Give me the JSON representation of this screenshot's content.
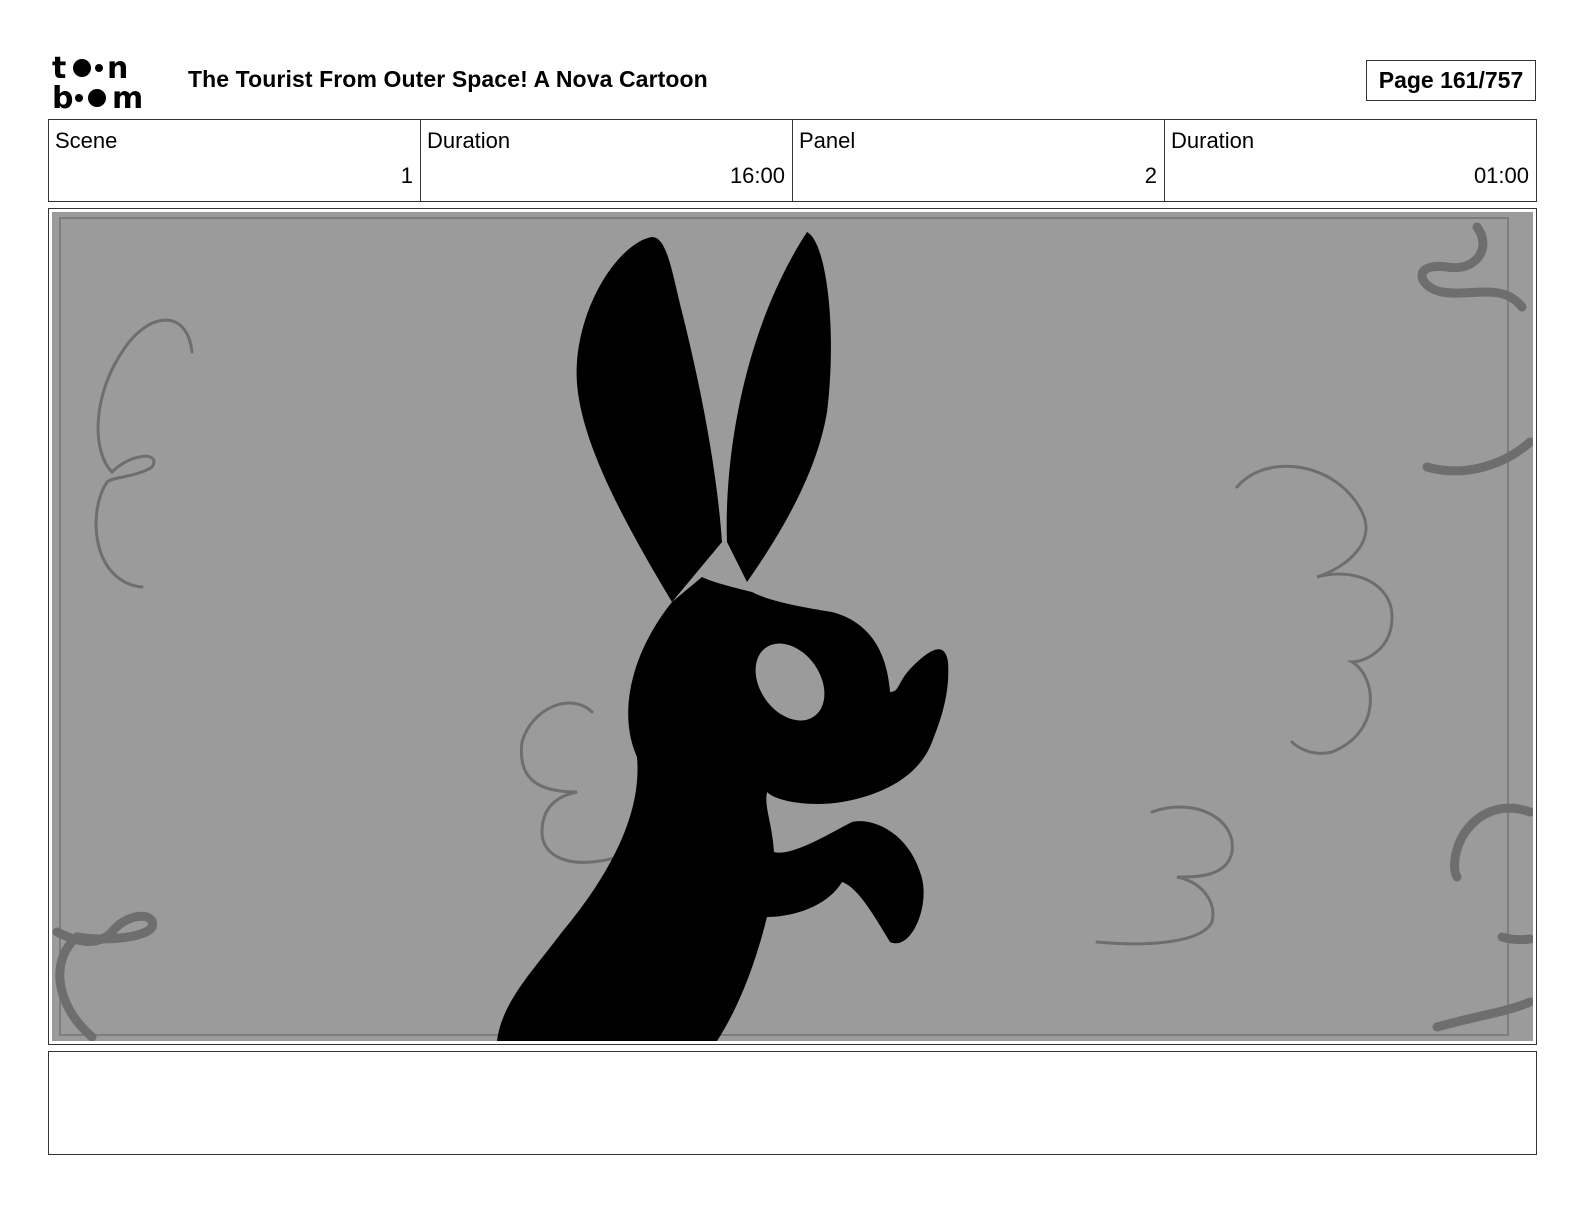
{
  "header": {
    "logo_text_top": "toon",
    "logo_text_bottom": "boom",
    "title": "The Tourist From Outer Space!  A Nova Cartoon",
    "page": "Page 161/757"
  },
  "info": [
    {
      "label": "Scene",
      "value": "1"
    },
    {
      "label": "Duration",
      "value": "16:00"
    },
    {
      "label": "Panel",
      "value": "2"
    },
    {
      "label": "Duration",
      "value": "01:00"
    }
  ],
  "panel": {
    "description": "",
    "colors": {
      "background": "#9b9b9b",
      "silhouette": "#000000",
      "cloud_lines": "#6e6e6e"
    }
  },
  "notes": {
    "text": ""
  }
}
